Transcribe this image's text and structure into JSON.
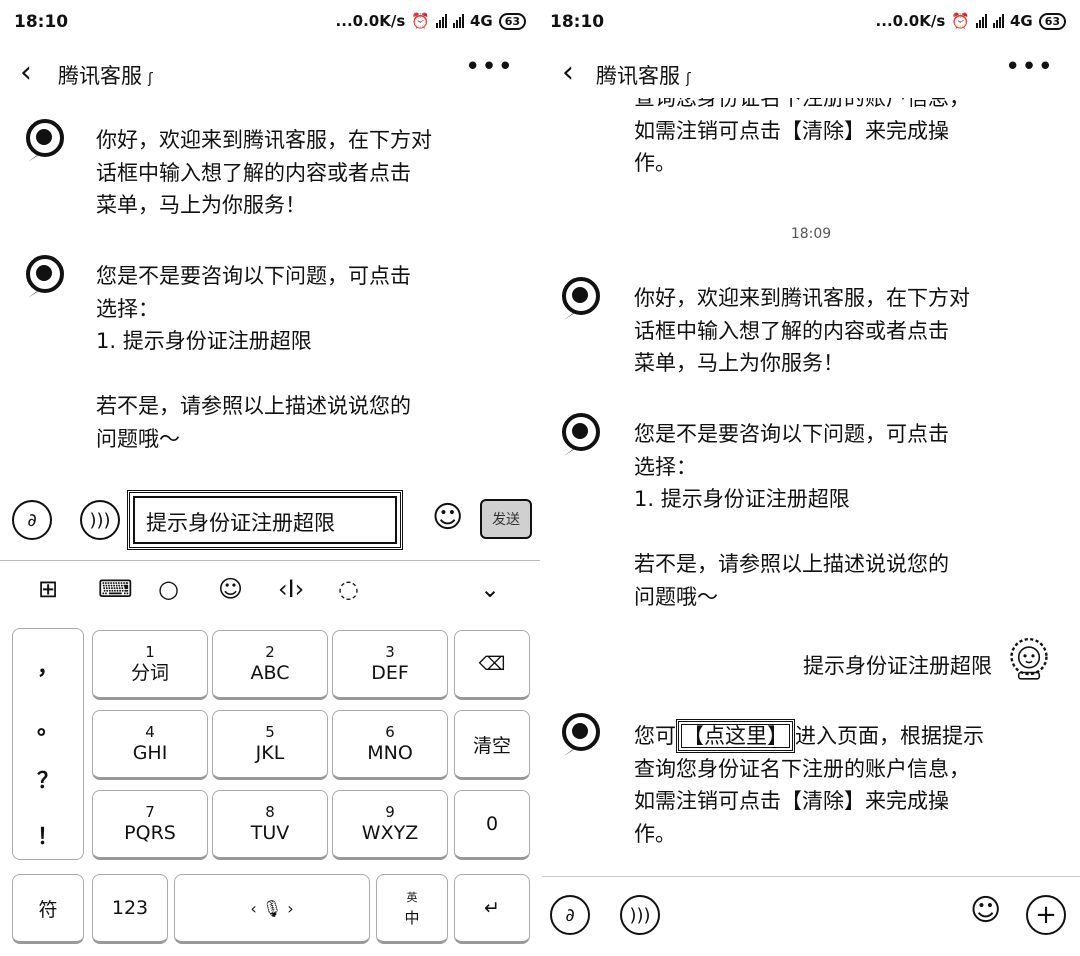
{
  "left": {
    "status": {
      "time": "18:10",
      "net": "...0.0K/s",
      "network_type": "4G",
      "battery": "63"
    },
    "header": {
      "title": "腾讯客服"
    },
    "messages": [
      {
        "text": "你好，欢迎来到腾讯客服，在下方对\n话框中输入想了解的内容或者点击\n菜单，马上为你服务！"
      },
      {
        "text": "您是不是要咨询以下问题，可点击\n选择：\n1. 提示身份证注册超限\n\n若不是，请参照以上描述说说您的\n问题哦～"
      }
    ],
    "input": {
      "value": "提示身份证注册超限",
      "send_label": "发送"
    },
    "keyboard": {
      "punctuation": [
        "，",
        "。",
        "？",
        "！"
      ],
      "rows": [
        [
          {
            "num": "1",
            "let": "分词"
          },
          {
            "num": "2",
            "let": "ABC"
          },
          {
            "num": "3",
            "let": "DEF"
          }
        ],
        [
          {
            "num": "4",
            "let": "GHI"
          },
          {
            "num": "5",
            "let": "JKL"
          },
          {
            "num": "6",
            "let": "MNO"
          }
        ],
        [
          {
            "num": "7",
            "let": "PQRS"
          },
          {
            "num": "8",
            "let": "TUV"
          },
          {
            "num": "9",
            "let": "WXYZ"
          }
        ]
      ],
      "clear_label": "清空",
      "zero_label": "0",
      "symbol_label": "符",
      "num_label": "123",
      "lang_top": "英",
      "lang_label": "中"
    }
  },
  "right": {
    "status": {
      "time": "18:10",
      "net": "...0.0K/s",
      "network_type": "4G",
      "battery": "63"
    },
    "header": {
      "title": "腾讯客服"
    },
    "top_partial_text": "查询您身份证名下注册的账户信息，\n如需注销可点击【清除】来完成操\n作。",
    "timestamp": "18:09",
    "messages": [
      {
        "text": "你好，欢迎来到腾讯客服，在下方对\n话框中输入想了解的内容或者点击\n菜单，马上为你服务！"
      },
      {
        "text": "您是不是要咨询以下问题，可点击\n选择：\n1. 提示身份证注册超限\n\n若不是，请参照以上描述说说您的\n问题哦～"
      }
    ],
    "user_message": "提示身份证注册超限",
    "reply": {
      "prefix": "您可",
      "link": "【点这里】",
      "suffix": "进入页面，根据提示\n查询您身份证名下注册的账户信息，\n如需注销可点击【清除】来完成操\n作。"
    }
  }
}
